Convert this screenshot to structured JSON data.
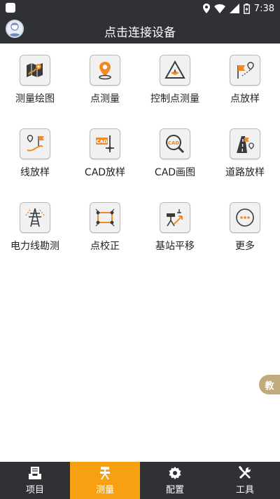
{
  "status_bar": {
    "time": "7:38"
  },
  "header": {
    "title": "点击连接设备"
  },
  "grid": {
    "items": [
      {
        "label": "测量绘图",
        "icon": "survey-map-icon"
      },
      {
        "label": "点测量",
        "icon": "point-pin-icon"
      },
      {
        "label": "控制点测量",
        "icon": "control-triangle-icon"
      },
      {
        "label": "点放样",
        "icon": "point-stakeout-icon"
      },
      {
        "label": "线放样",
        "icon": "line-stakeout-icon"
      },
      {
        "label": "CAD放样",
        "icon": "cad-stakeout-icon"
      },
      {
        "label": "CAD画图",
        "icon": "cad-search-icon"
      },
      {
        "label": "道路放样",
        "icon": "road-stakeout-icon"
      },
      {
        "label": "电力线勘测",
        "icon": "power-tower-icon"
      },
      {
        "label": "点校正",
        "icon": "point-correction-icon"
      },
      {
        "label": "基站平移",
        "icon": "base-station-shift-icon"
      },
      {
        "label": "更多",
        "icon": "more-icon"
      }
    ],
    "cad_text": "CAD"
  },
  "side_tab": {
    "label": "教"
  },
  "bottom_nav": {
    "items": [
      {
        "label": "项目",
        "icon": "project-tray-icon"
      },
      {
        "label": "测量",
        "icon": "survey-instrument-icon"
      },
      {
        "label": "配置",
        "icon": "gear-icon"
      },
      {
        "label": "工具",
        "icon": "tools-icon"
      }
    ]
  },
  "colors": {
    "accent": "#f6a012",
    "header_bg": "#2f3135",
    "icon_orange": "#f08a24"
  }
}
